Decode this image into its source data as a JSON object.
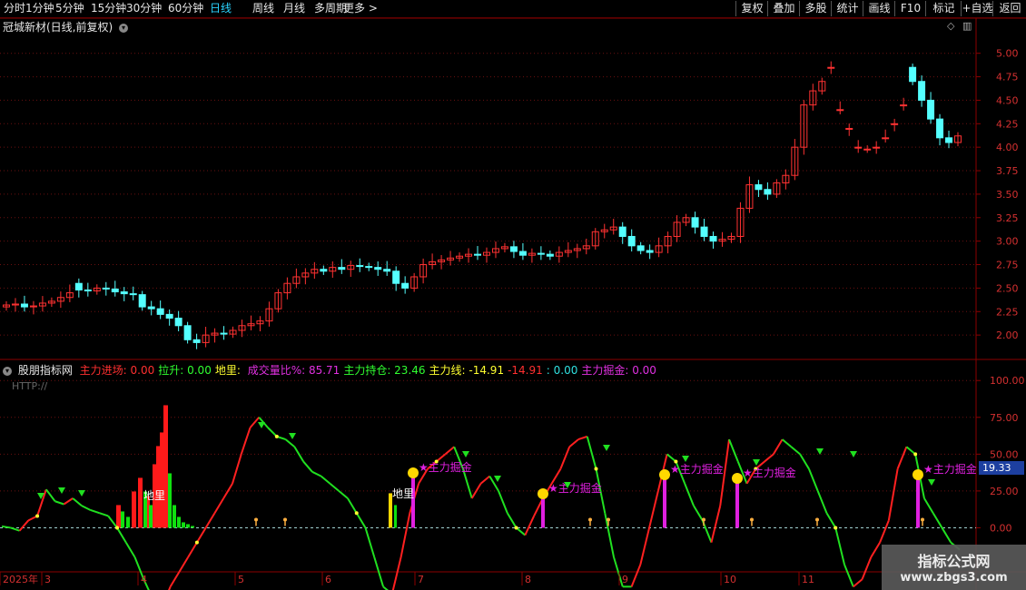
{
  "topbar": {
    "periods": [
      "分时",
      "1分钟",
      "5分钟",
      "15分钟",
      "30分钟",
      "60分钟",
      "日线",
      "周线",
      "月线",
      "多周期",
      "更多 >"
    ],
    "active_period": "日线",
    "buttons": [
      "复权",
      "叠加",
      "多股",
      "统计",
      "画线",
      "F10",
      "+自选",
      "返回"
    ],
    "mark_button": "标记"
  },
  "main_panel": {
    "title": "冠城新材(日线,前复权)",
    "y_ticks": [
      "5.00",
      "4.75",
      "4.50",
      "4.25",
      "4.00",
      "3.75",
      "3.50",
      "3.25",
      "3.00",
      "2.75",
      "2.50",
      "2.25",
      "2.00"
    ]
  },
  "indicator_panel": {
    "name": "股朋指标网",
    "http_text": "HTTP://",
    "fields": [
      {
        "label": "主力进场:",
        "value": "0.00",
        "color": "#ff3030"
      },
      {
        "label": "拉升:",
        "value": "0.00",
        "color": "#30ff30"
      },
      {
        "label": "地里:",
        "value": "",
        "color": "#ffff30"
      },
      {
        "label": "成交量比%:",
        "value": "85.71",
        "color": "#e030e0"
      },
      {
        "label": "主力持仓:",
        "value": "23.46",
        "color": "#30ff30"
      },
      {
        "label": "主力线:",
        "value": "-14.91",
        "color": "#ffff30"
      },
      {
        "label": "",
        "value": "-14.91",
        "color": "#ff3030"
      },
      {
        "label": ":",
        "value": "0.00",
        "color": "#30e0e0"
      },
      {
        "label": "主力掘金:",
        "value": "0.00",
        "color": "#e030e0"
      }
    ],
    "y_ticks": [
      "100.00",
      "75.00",
      "50.00",
      "25.00",
      "0.00"
    ],
    "current_value": "19.33",
    "signal_label": "★主力掘金",
    "ground_label": "地里"
  },
  "x_axis": {
    "labels": [
      "2025年",
      "3",
      "4",
      "5",
      "6",
      "7",
      "8",
      "9",
      "10",
      "11"
    ]
  },
  "watermark": {
    "line1": "指标公式网",
    "line2": "www.zbgs3.com"
  },
  "colors": {
    "up": "#ff3232",
    "down": "#54ffff",
    "grid": "#6a1010",
    "axis": "#8b0000"
  },
  "chart_data": [
    {
      "type": "candlestick",
      "title": "冠城新材(日线,前复权)",
      "ylim": [
        1.75,
        5.2
      ],
      "close": [
        2.32,
        2.33,
        2.3,
        2.31,
        2.34,
        2.36,
        2.4,
        2.45,
        2.48,
        2.47,
        2.5,
        2.49,
        2.46,
        2.44,
        2.43,
        2.3,
        2.28,
        2.22,
        2.18,
        2.1,
        1.95,
        1.92,
        2.0,
        2.02,
        2.01,
        2.05,
        2.1,
        2.12,
        2.15,
        2.28,
        2.45,
        2.55,
        2.62,
        2.66,
        2.7,
        2.68,
        2.72,
        2.7,
        2.74,
        2.73,
        2.72,
        2.7,
        2.68,
        2.55,
        2.5,
        2.62,
        2.75,
        2.78,
        2.8,
        2.82,
        2.84,
        2.86,
        2.85,
        2.88,
        2.92,
        2.94,
        2.89,
        2.85,
        2.87,
        2.86,
        2.84,
        2.88,
        2.9,
        2.92,
        2.95,
        3.1,
        3.12,
        3.15,
        3.05,
        2.95,
        2.9,
        2.88,
        2.95,
        3.05,
        3.2,
        3.25,
        3.15,
        3.05,
        3.0,
        3.02,
        3.05,
        3.35,
        3.6,
        3.55,
        3.5,
        3.62,
        3.7,
        4.0,
        4.45,
        4.6,
        4.7,
        4.85,
        4.4,
        4.2,
        4.0,
        3.98,
        4.0,
        4.1,
        4.25,
        4.45,
        4.7,
        4.5,
        4.3,
        4.1,
        4.05,
        4.12
      ],
      "open": [
        2.3,
        2.32,
        2.33,
        2.3,
        2.31,
        2.34,
        2.36,
        2.4,
        2.55,
        2.48,
        2.47,
        2.5,
        2.49,
        2.46,
        2.44,
        2.43,
        2.3,
        2.28,
        2.22,
        2.18,
        2.1,
        1.95,
        1.92,
        2.0,
        2.02,
        2.01,
        2.05,
        2.1,
        2.12,
        2.15,
        2.28,
        2.45,
        2.55,
        2.62,
        2.66,
        2.7,
        2.68,
        2.72,
        2.7,
        2.74,
        2.73,
        2.72,
        2.7,
        2.68,
        2.55,
        2.5,
        2.62,
        2.75,
        2.78,
        2.8,
        2.82,
        2.84,
        2.86,
        2.85,
        2.88,
        2.92,
        2.94,
        2.89,
        2.85,
        2.87,
        2.86,
        2.84,
        2.88,
        2.9,
        2.92,
        2.95,
        3.1,
        3.12,
        3.15,
        3.05,
        2.95,
        2.9,
        2.88,
        2.95,
        3.05,
        3.2,
        3.25,
        3.15,
        3.05,
        3.0,
        3.02,
        3.05,
        3.35,
        3.6,
        3.55,
        3.5,
        3.62,
        3.7,
        4.0,
        4.45,
        4.6,
        4.85,
        4.4,
        4.2,
        4.0,
        3.98,
        4.0,
        4.1,
        4.25,
        4.45,
        4.85,
        4.7,
        4.5,
        4.3,
        4.1,
        4.05
      ]
    },
    {
      "type": "line",
      "name": "主力线",
      "ylim": [
        -25,
        110
      ],
      "values": [
        1,
        0,
        -2,
        5,
        8,
        26,
        18,
        16,
        20,
        15,
        12,
        10,
        8,
        0,
        -10,
        -20,
        -35,
        -48,
        -55,
        -40,
        -30,
        -20,
        -10,
        0,
        10,
        20,
        30,
        50,
        68,
        75,
        68,
        62,
        60,
        55,
        45,
        38,
        35,
        30,
        25,
        20,
        10,
        0,
        -20,
        -40,
        -45,
        -20,
        10,
        30,
        40,
        45,
        50,
        55,
        40,
        20,
        30,
        35,
        25,
        10,
        0,
        -5,
        8,
        20,
        30,
        40,
        55,
        60,
        62,
        40,
        10,
        -20,
        -40,
        -40,
        -25,
        0,
        25,
        50,
        45,
        30,
        15,
        5,
        -10,
        15,
        60,
        45,
        30,
        40,
        45,
        50,
        60,
        55,
        50,
        40,
        25,
        10,
        0,
        -25,
        -40,
        -35,
        -20,
        -10,
        5,
        40,
        55,
        50,
        20,
        10,
        0,
        -10,
        -14.91
      ]
    },
    {
      "type": "bar",
      "name": "主力进场",
      "values": [
        0,
        0,
        0,
        0,
        0,
        0,
        0,
        0,
        0,
        0,
        0,
        0,
        0,
        0,
        0,
        0,
        0,
        0,
        0,
        0,
        0,
        0,
        0,
        0,
        0,
        0,
        0,
        0,
        0,
        0,
        0,
        0,
        0,
        0,
        0,
        0,
        0,
        0,
        0,
        0,
        0,
        0,
        0,
        0,
        0,
        0,
        0,
        0,
        0,
        0,
        0,
        0,
        0,
        0,
        0,
        0,
        0,
        0,
        0,
        0,
        0,
        0,
        0,
        0,
        0,
        0,
        0,
        0,
        0,
        0,
        0,
        0,
        0,
        0,
        0,
        0,
        0,
        0,
        0,
        0,
        0,
        0,
        0,
        0,
        0,
        0,
        0,
        0,
        0,
        0,
        0,
        0,
        0,
        0,
        0,
        0,
        0,
        0,
        0,
        0,
        0,
        0,
        0,
        0,
        0,
        0,
        0
      ]
    }
  ]
}
